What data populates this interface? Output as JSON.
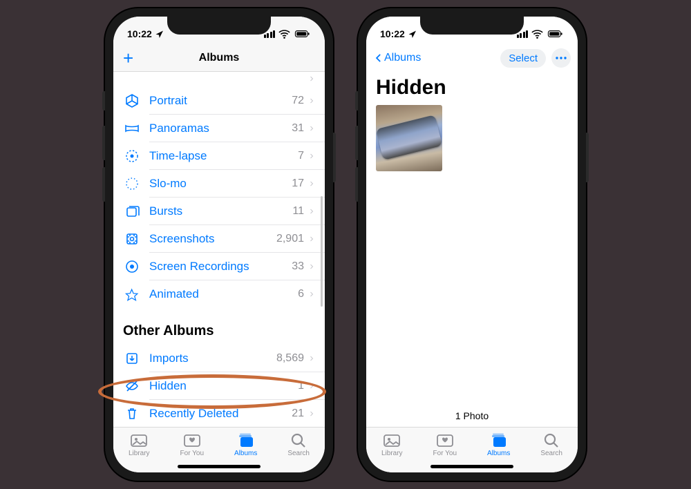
{
  "colors": {
    "accent": "#007aff",
    "highlight": "#c86c3a"
  },
  "status": {
    "time": "10:22"
  },
  "phone1": {
    "nav_title": "Albums",
    "media_types": [
      {
        "icon": "cube",
        "label": "Portrait",
        "count": "72"
      },
      {
        "icon": "pano",
        "label": "Panoramas",
        "count": "31"
      },
      {
        "icon": "timelapse",
        "label": "Time-lapse",
        "count": "7"
      },
      {
        "icon": "slomo",
        "label": "Slo-mo",
        "count": "17"
      },
      {
        "icon": "bursts",
        "label": "Bursts",
        "count": "11"
      },
      {
        "icon": "screenshot",
        "label": "Screenshots",
        "count": "2,901"
      },
      {
        "icon": "record",
        "label": "Screen Recordings",
        "count": "33"
      },
      {
        "icon": "animated",
        "label": "Animated",
        "count": "6"
      }
    ],
    "other_header": "Other Albums",
    "other_albums": [
      {
        "icon": "imports",
        "label": "Imports",
        "count": "8,569"
      },
      {
        "icon": "hidden",
        "label": "Hidden",
        "count": "1"
      },
      {
        "icon": "trash",
        "label": "Recently Deleted",
        "count": "21"
      }
    ],
    "highlighted_index": 1
  },
  "phone2": {
    "back_label": "Albums",
    "select_label": "Select",
    "title": "Hidden",
    "footer": "1 Photo"
  },
  "tabbar": {
    "items": [
      {
        "id": "library",
        "label": "Library"
      },
      {
        "id": "foryou",
        "label": "For You"
      },
      {
        "id": "albums",
        "label": "Albums"
      },
      {
        "id": "search",
        "label": "Search"
      }
    ],
    "active": "albums"
  }
}
